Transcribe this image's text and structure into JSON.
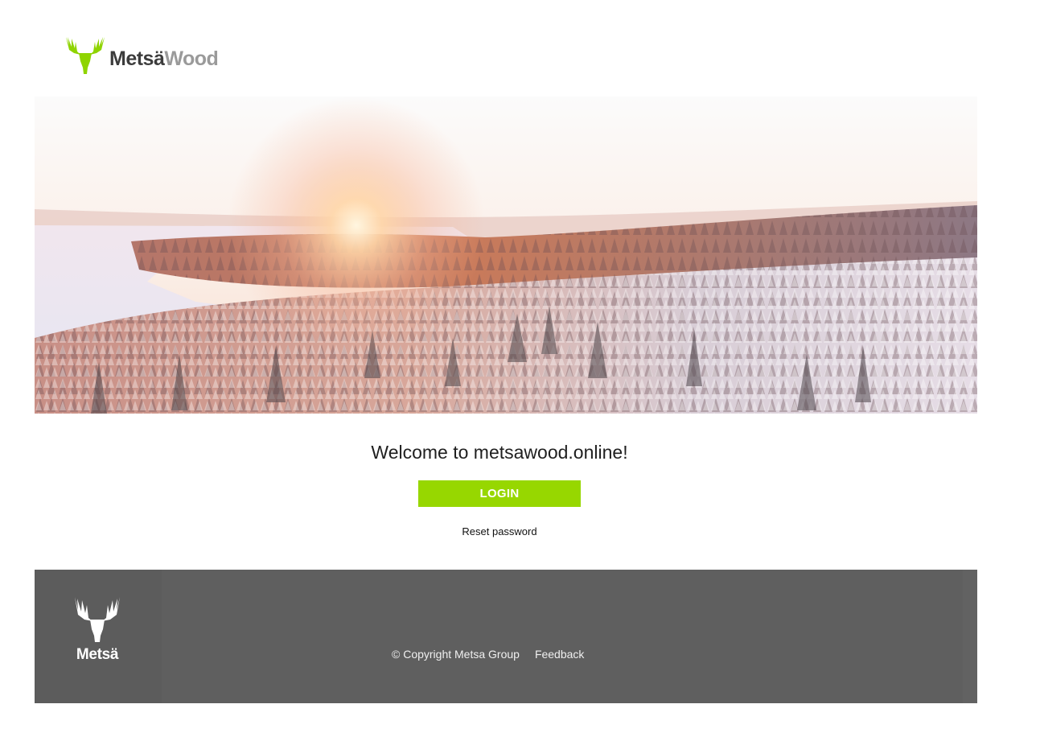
{
  "brand": {
    "logo_part1": "Metsä",
    "logo_part2": "Wood",
    "accent_color": "#97d700"
  },
  "hero": {
    "image": "winter-forest-sunrise-landscape"
  },
  "main": {
    "welcome_text": "Welcome to metsawood.online!",
    "login_label": "LOGIN",
    "reset_password_label": "Reset password"
  },
  "footer": {
    "logo_text": "Metsä",
    "copyright": "© Copyright Metsa Group",
    "feedback_label": "Feedback",
    "background_color": "#5f5f5f"
  }
}
